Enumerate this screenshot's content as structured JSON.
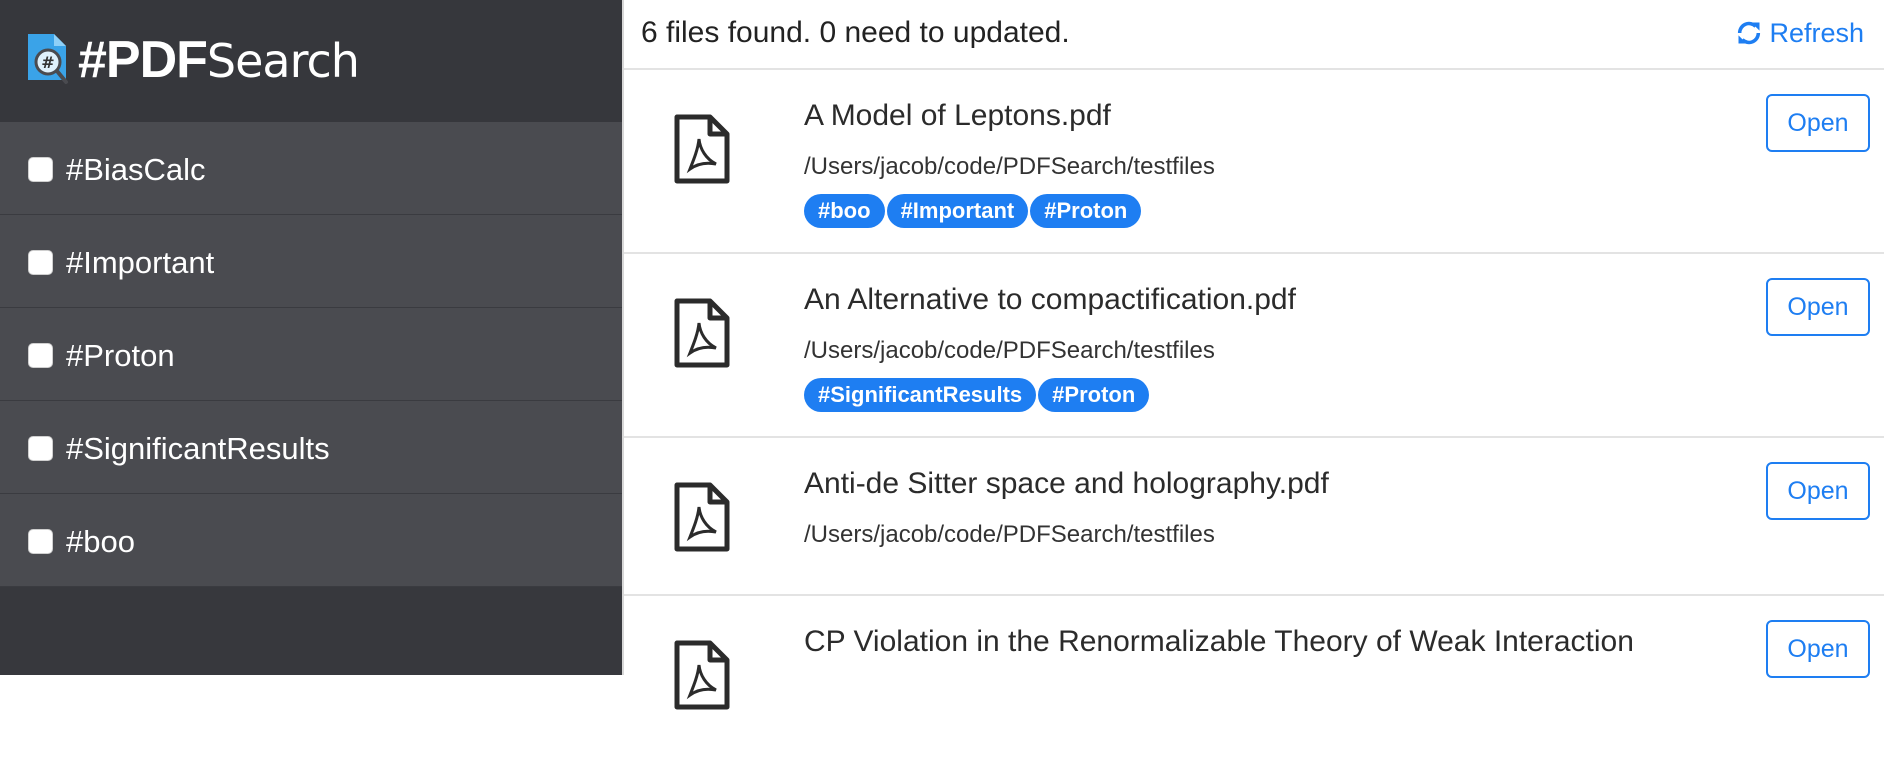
{
  "app": {
    "brand_bold": "#PDF",
    "brand_thin": "Search",
    "logo_icon": "pdf-search-logo-icon",
    "logo_glyph": "#"
  },
  "sidebar": {
    "tags": [
      {
        "label": "#BiasCalc",
        "checked": false
      },
      {
        "label": "#Important",
        "checked": false
      },
      {
        "label": "#Proton",
        "checked": false
      },
      {
        "label": "#SignificantResults",
        "checked": false
      },
      {
        "label": "#boo",
        "checked": false
      }
    ]
  },
  "header": {
    "status": "6 files found. 0 need to updated.",
    "refresh_label": "Refresh",
    "refresh_icon": "refresh-icon"
  },
  "files": [
    {
      "name": "A Model of Leptons.pdf",
      "path": "/Users/jacob/code/PDFSearch/testfiles",
      "tags": [
        "#boo",
        "#Important",
        "#Proton"
      ],
      "open_label": "Open"
    },
    {
      "name": "An Alternative to compactification.pdf",
      "path": "/Users/jacob/code/PDFSearch/testfiles",
      "tags": [
        "#SignificantResults",
        "#Proton"
      ],
      "open_label": "Open"
    },
    {
      "name": "Anti-de Sitter space and holography.pdf",
      "path": "/Users/jacob/code/PDFSearch/testfiles",
      "tags": [],
      "open_label": "Open"
    },
    {
      "name": "CP Violation in the Renormalizable Theory of Weak Interaction",
      "path": "",
      "tags": [],
      "open_label": "Open"
    }
  ],
  "colors": {
    "accent": "#1e7ef2",
    "sidebar_bg": "#37383d",
    "tag_row_bg": "#4a4b50"
  }
}
